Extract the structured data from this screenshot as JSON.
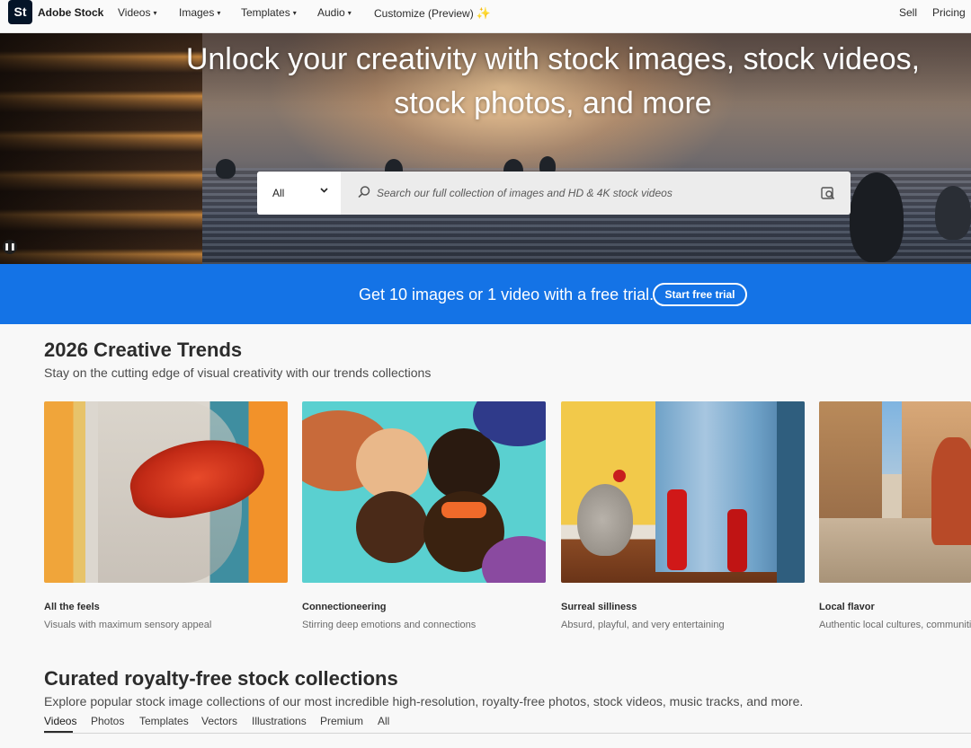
{
  "nav": {
    "logo_text": "St",
    "brand": "Adobe Stock",
    "items": [
      {
        "label": "Videos",
        "chevron": "⌄"
      },
      {
        "label": "Images",
        "chevron": "⌄"
      },
      {
        "label": "Templates",
        "chevron": "⌄"
      },
      {
        "label": "Audio",
        "chevron": "⌄"
      },
      {
        "label": "Customize (Preview)",
        "icon": "sparkle-icon"
      }
    ],
    "right": {
      "sell": "Sell",
      "pricing": "Pricing"
    }
  },
  "hero": {
    "title": "Unlock your creativity with stock images, stock videos, stock photos, and more",
    "search": {
      "category": "All",
      "placeholder": "Search our full collection of images and HD & 4K stock videos"
    }
  },
  "promo": {
    "text": "Get 10 images or 1 video with a free trial.",
    "button": "Start free trial"
  },
  "trends": {
    "title": "2026 Creative Trends",
    "subtitle": "Stay on the cutting edge of visual creativity with our trends collections",
    "cards": [
      {
        "title": "All the feels",
        "subtitle": "Visuals with maximum sensory appeal"
      },
      {
        "title": "Connectioneering",
        "subtitle": "Stirring deep emotions and connections"
      },
      {
        "title": "Surreal silliness",
        "subtitle": "Absurd, playful, and very entertaining"
      },
      {
        "title": "Local flavor",
        "subtitle": "Authentic local cultures, communities"
      }
    ]
  },
  "collections": {
    "title": "Curated royalty-free stock collections",
    "subtitle": "Explore popular stock image collections of our most incredible high-resolution, royalty-free photos, stock videos, music tracks, and more.",
    "tabs": [
      "Videos",
      "Photos",
      "Templates",
      "Vectors",
      "Illustrations",
      "Premium",
      "All"
    ],
    "active_tab": "Videos"
  },
  "colors": {
    "promo_blue": "#1473e6",
    "logo_navy": "#041428"
  }
}
